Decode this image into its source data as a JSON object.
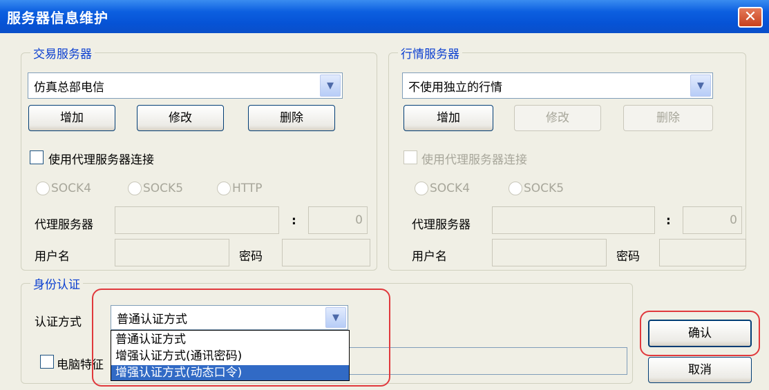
{
  "window": {
    "title": "服务器信息维护",
    "close_icon": "close-icon"
  },
  "trade": {
    "legend": "交易服务器",
    "server_selected": "仿真总部电信",
    "buttons": {
      "add": "增加",
      "modify": "修改",
      "delete": "删除"
    },
    "use_proxy": "使用代理服务器连接",
    "proxy_types": [
      "SOCK4",
      "SOCK5",
      "HTTP"
    ],
    "proxy_server_label": "代理服务器",
    "colon": ":",
    "port_value": "0",
    "username_label": "用户名",
    "password_label": "密码"
  },
  "quote": {
    "legend": "行情服务器",
    "server_selected": "不使用独立的行情",
    "buttons": {
      "add": "增加",
      "modify": "修改",
      "delete": "删除"
    },
    "use_proxy": "使用代理服务器连接",
    "proxy_types": [
      "SOCK4",
      "SOCK5"
    ],
    "proxy_server_label": "代理服务器",
    "colon": ":",
    "port_value": "0",
    "username_label": "用户名",
    "password_label": "密码"
  },
  "auth": {
    "legend": "身份认证",
    "method_label": "认证方式",
    "method_selected": "普通认证方式",
    "options": [
      "普通认证方式",
      "增强认证方式(通讯密码)",
      "增强认证方式(动态口令)"
    ],
    "pc_feature_label": "电脑特征"
  },
  "actions": {
    "confirm": "确认",
    "cancel": "取消"
  },
  "colors": {
    "title_bar": "#0653d6",
    "legend_text": "#0b3fd0",
    "highlight": "#316ac5",
    "annotation": "#e0383c"
  }
}
